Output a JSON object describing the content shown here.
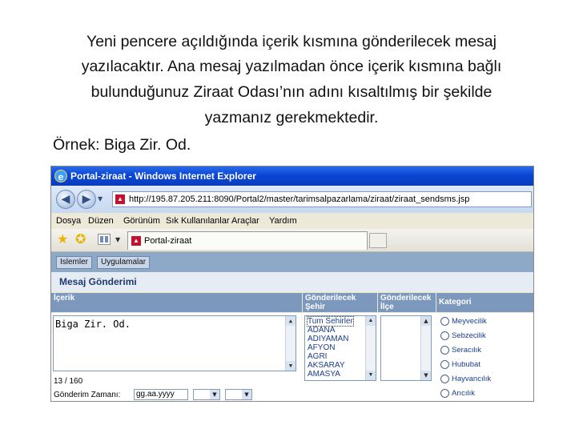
{
  "slide": {
    "paragraph_lines": [
      "Yeni pencere açıldığında içerik kısmına gönderilecek mesaj",
      "yazılacaktır. Ana mesaj yazılmadan önce içerik kısmına bağlı",
      "bulunduğunuz Ziraat Odası’nın adını kısaltılmış bir şekilde",
      "yazmanız gerekmektedir."
    ],
    "example": "Örnek: Biga Zir. Od."
  },
  "browser": {
    "window_title": "Portal-ziraat - Windows Internet Explorer",
    "url": "http://195.87.205.211:8090/Portal2/master/tarimsalpazarlama/ziraat/ziraat_sendsms.jsp",
    "menu": [
      "Dosya",
      "Düzen",
      "Görünüm",
      "Sık Kullanılanlar",
      "Araçlar",
      "Yardım"
    ],
    "tab_title": "Portal-ziraat"
  },
  "app": {
    "nav_tabs": [
      "Islemler",
      "Uygulamalar"
    ],
    "page_title": "Mesaj Gönderimi",
    "headers": {
      "content": "İçerik",
      "city_line1": "Gönderilecek",
      "city_line2": "Şehir",
      "district_line1": "Gönderilecek",
      "district_line2": "İlçe",
      "category": "Kategori"
    },
    "message_text": "Biga Zir. Od.",
    "char_count": "13 / 160",
    "send_time_label": "Gönderim Zamanı:",
    "date_placeholder": "gg.aa.yyyy",
    "cities": [
      "Tum Sehirler",
      "ADANA",
      "ADIYAMAN",
      "AFYON",
      "AGRI",
      "AKSARAY",
      "AMASYA"
    ],
    "categories": [
      "Meyvecilik",
      "Sebzecilik",
      "Seracılık",
      "Hububat",
      "Hayvancılık",
      "Arıcılık"
    ]
  },
  "colors": {
    "titlebar": "#0a46d6",
    "app_nav": "#8ea8c8",
    "form_header": "#7d98bd",
    "link_text": "#1a3c8c"
  }
}
